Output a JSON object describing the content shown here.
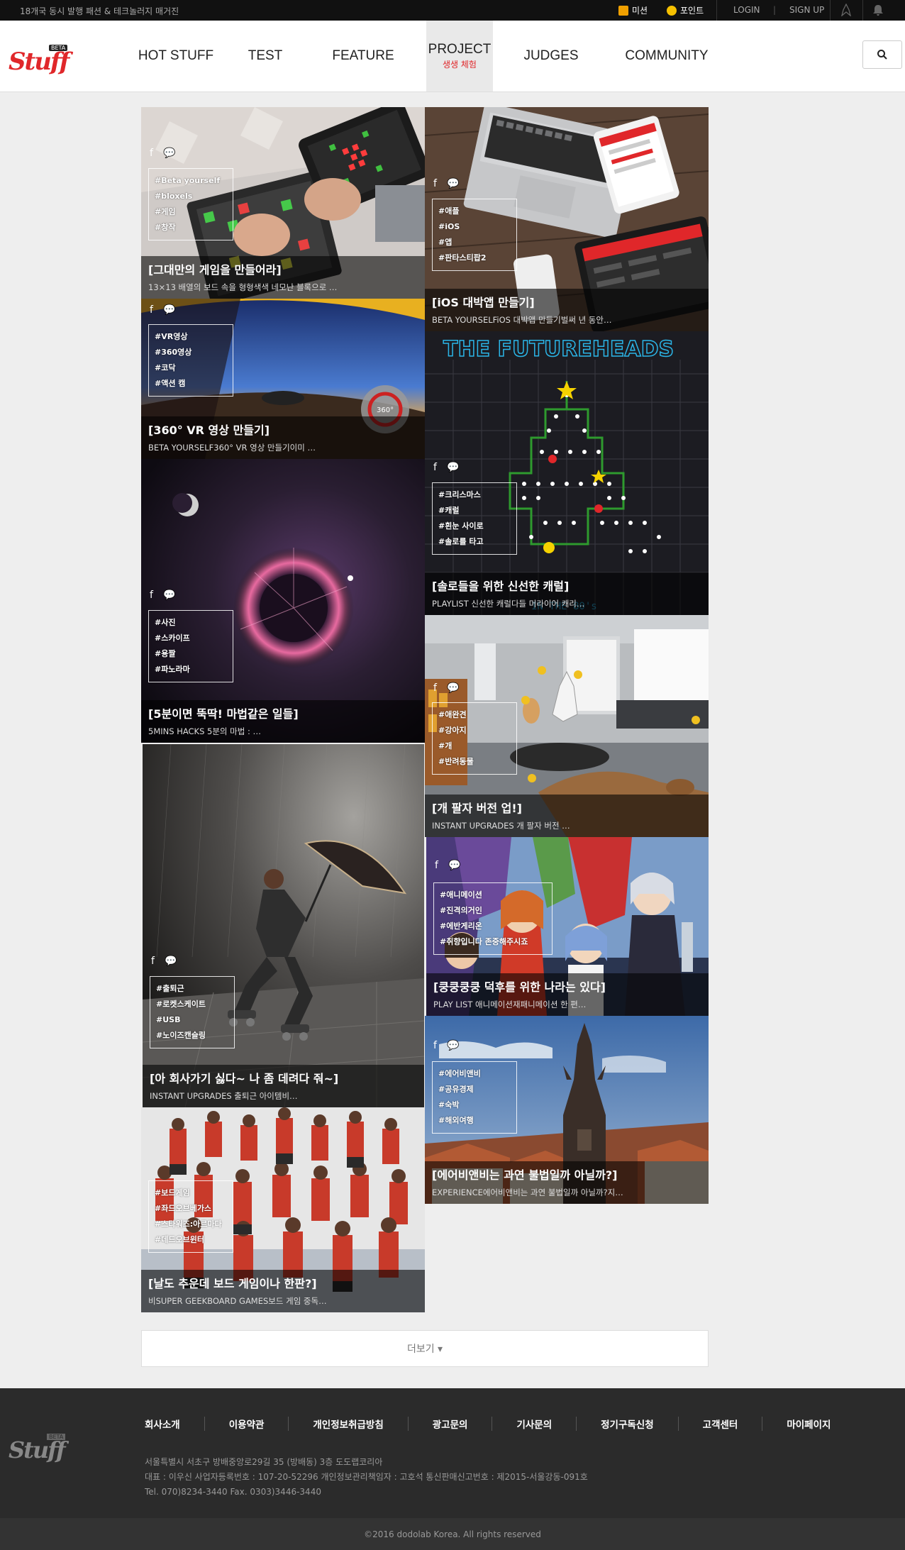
{
  "topbar": {
    "tagline": "18개국 동시 발행 패션 & 테크놀러지 매거진",
    "mission": "미션",
    "point": "포인트",
    "login": "LOGIN",
    "divider": "|",
    "signup": "SIGN UP"
  },
  "header": {
    "logo_text": "Stuff",
    "logo_badge": "BETA",
    "nav": [
      {
        "label": "HOT STUFF",
        "sub": ""
      },
      {
        "label": "TEST",
        "sub": ""
      },
      {
        "label": "FEATURE",
        "sub": ""
      },
      {
        "label": "PROJECT",
        "sub": "생생 체험"
      },
      {
        "label": "JUDGES",
        "sub": ""
      },
      {
        "label": "COMMUNITY",
        "sub": ""
      }
    ]
  },
  "cards": [
    {
      "title": "[그대만의 게임을 만들어라]",
      "summary": "13×13 배열의 보드 속을 형형색색 네모난 블록으로 …",
      "tags": [
        "#Beta yourself",
        "#bloxels",
        "#게임",
        "#창작"
      ]
    },
    {
      "title": "[iOS 대박앱 만들기]",
      "summary": "BETA YOURSELFiOS 대박앱 만들기벌써 년 동안…",
      "tags": [
        "#애플",
        "#iOS",
        "#앱",
        "#판타스티팝2"
      ]
    },
    {
      "title": "[360° VR 영상 만들기]",
      "summary": "BETA YOURSELF360° VR 영상 만들기이미 …",
      "tags": [
        "#VR영상",
        "#360영상",
        "#코닥",
        "#액션 캠"
      ]
    },
    {
      "title": "[솔로들을 위한 신선한 캐럴]",
      "summary": "PLAYLIST 신선한 캐럴다들 머라이어 캐리…",
      "tags": [
        "#크리스마스",
        "#캐럴",
        "#흰눈 사이로",
        "#솔로를 타고"
      ]
    },
    {
      "title": "[5분이면 뚝딱! 마법같은 일들]",
      "summary": "5MINS HACKS 5분의 마법 : …",
      "tags": [
        "#사진",
        "#스카이프",
        "#용짤",
        "#파노라마"
      ]
    },
    {
      "title": "[개 팔자 버전 업!]",
      "summary": "INSTANT UPGRADES 개 팔자 버전 …",
      "tags": [
        "#애완견",
        "#강아지",
        "#개",
        "#반려동물"
      ]
    },
    {
      "title": "[아 회사가기 싫다~ 나 좀 데려다 줘~]",
      "summary": "INSTANT UPGRADES 출퇴근 아이템비…",
      "tags": [
        "#출퇴근",
        "#로켓스케이트",
        "#USB",
        "#노이즈캔슬링"
      ]
    },
    {
      "title": "[쿵쿵쿵쿵 덕후를 위한 나라는 있다]",
      "summary": "PLAY LIST 애니메이션재패니메이션 한 편…",
      "tags": [
        "#애니메이션",
        "#진격의거인",
        "#에반게리온",
        "#취향입니다 존중해주시죠"
      ]
    },
    {
      "title": "[에어비앤비는 과연 불법일까 아닐까?]",
      "summary": "EXPERIENCE에어비앤비는 과연 불법일까 아닐까?지…",
      "tags": [
        "#에어비앤비",
        "#공유경제",
        "#숙박",
        "#해외여행"
      ]
    },
    {
      "title": "[날도 추운데 보드 게임이나 한판?]",
      "summary": "비SUPER GEEKBOARD GAMES보드 게임 중독…",
      "tags": [
        "#보드게임",
        "#좌드오브베가스",
        "#스타워즈:아르마다",
        "#데드오브윈터"
      ]
    }
  ],
  "more_label": "더보기 ▾",
  "footer": {
    "links": [
      "회사소개",
      "이용약관",
      "개인정보취급방침",
      "광고문의",
      "기사문의",
      "정기구독신청",
      "고객센터",
      "마이페이지"
    ],
    "address_line1": "서울특별시 서초구 방배중앙로29길 35 (방배동) 3층 도도랩코리아",
    "address_line2": "대표 : 이우신    사업자등록번호 : 107-20-52296    개인정보관리책임자 : 고호석    통신판매신고번호 : 제2015-서울강동-091호",
    "address_line3": "Tel. 070)8234-3440    Fax. 0303)3446-3440",
    "copyright": "©2016 dodolab Korea. All rights reserved"
  },
  "colors": {
    "brand_red": "#e0272a",
    "topbar": "#111111",
    "footer": "#2b2b2b"
  }
}
